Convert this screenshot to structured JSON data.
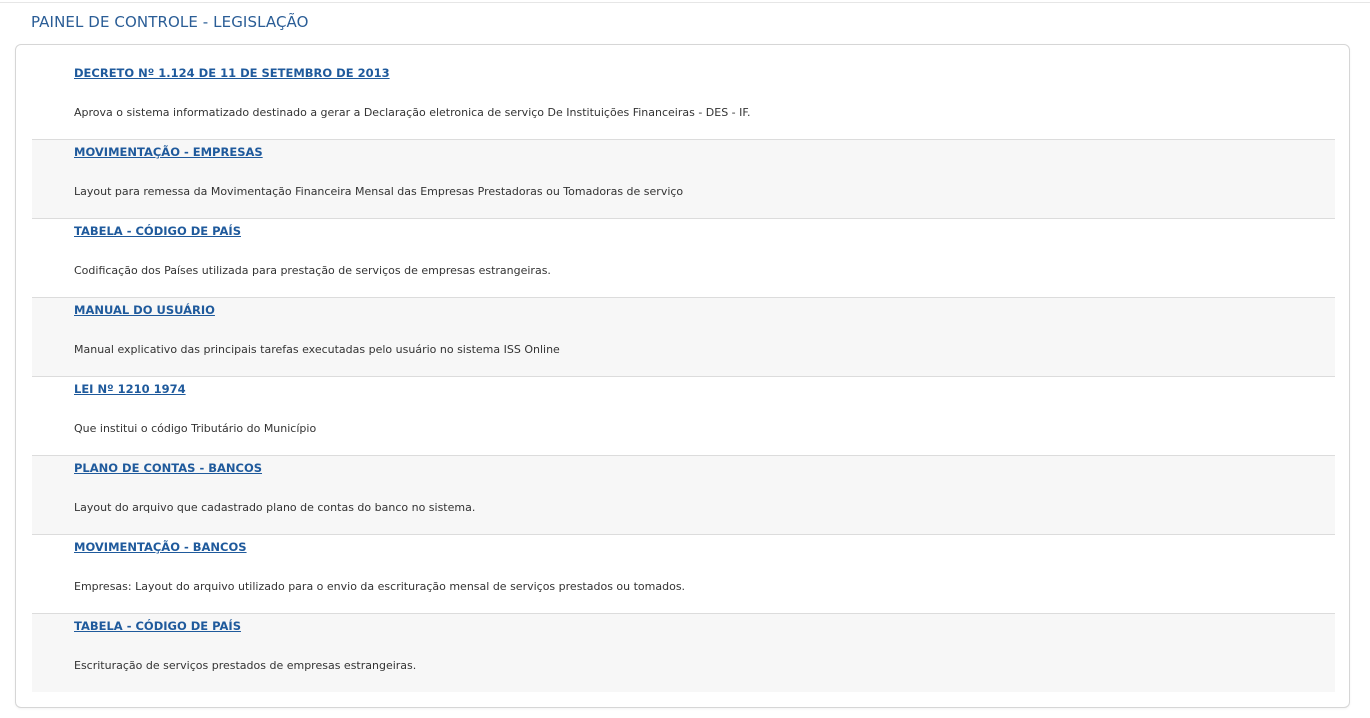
{
  "page": {
    "title": "PAINEL DE CONTROLE - LEGISLAÇÃO"
  },
  "items": [
    {
      "title": "DECRETO Nº 1.124 DE 11 DE SETEMBRO DE 2013",
      "description": "Aprova o sistema informatizado destinado a gerar a Declaração eletronica de serviço De Instituições Financeiras - DES - IF."
    },
    {
      "title": "MOVIMENTAÇÃO - EMPRESAS",
      "description": "Layout para remessa da Movimentação Financeira Mensal das Empresas Prestadoras ou Tomadoras de serviço"
    },
    {
      "title": "TABELA - CÓDIGO DE PAÍS",
      "description": "Codificação dos Países utilizada para prestação de serviços de empresas estrangeiras."
    },
    {
      "title": "MANUAL DO USUÁRIO",
      "description": "Manual explicativo das principais tarefas executadas pelo usuário no sistema ISS Online"
    },
    {
      "title": "LEI Nº 1210 1974",
      "description": "Que institui o código Tributário do Município"
    },
    {
      "title": "PLANO DE CONTAS - BANCOS",
      "description": "Layout do arquivo que cadastrado plano de contas do banco no sistema."
    },
    {
      "title": "MOVIMENTAÇÃO - BANCOS",
      "description": "Empresas: Layout do arquivo utilizado para o envio da escrituração mensal de serviços prestados ou tomados."
    },
    {
      "title": "TABELA - CÓDIGO DE PAÍS",
      "description": "Escrituração de serviços prestados de empresas estrangeiras."
    }
  ],
  "colors": {
    "title": "#2a5d96",
    "link": "#1f5a9c",
    "alt_row": "#f7f7f7",
    "text": "#333333"
  }
}
